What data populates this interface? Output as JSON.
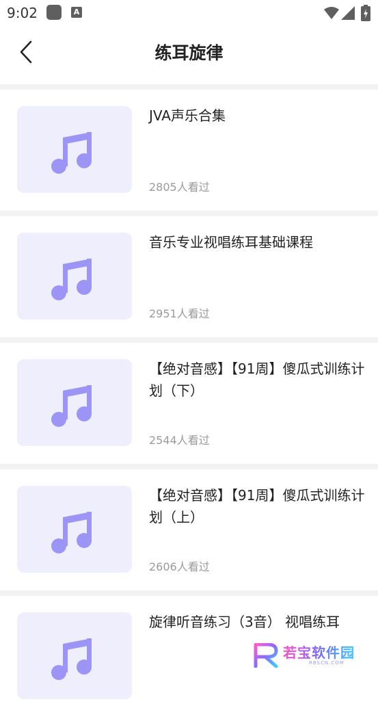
{
  "status": {
    "time": "9:02",
    "notif_letter": "A"
  },
  "header": {
    "title": "练耳旋律"
  },
  "items": [
    {
      "title": "JVA声乐合集",
      "views": "2805人看过"
    },
    {
      "title": "音乐专业视唱练耳基础课程",
      "views": "2951人看过"
    },
    {
      "title": "【绝对音感】【91周】傻瓜式训练计划（下）",
      "views": "2544人看过"
    },
    {
      "title": "【绝对音感】【91周】傻瓜式训练计划（上）",
      "views": "2606人看过"
    },
    {
      "title": "旋律听音练习（3音） 视唱练耳",
      "views": ""
    }
  ],
  "watermark": {
    "name": "若宝软件园",
    "sub": "RBSCN.COM"
  },
  "colors": {
    "accent": "#9c95f6",
    "thumb_bg": "#efeefd",
    "separator": "#f2f2f2"
  }
}
